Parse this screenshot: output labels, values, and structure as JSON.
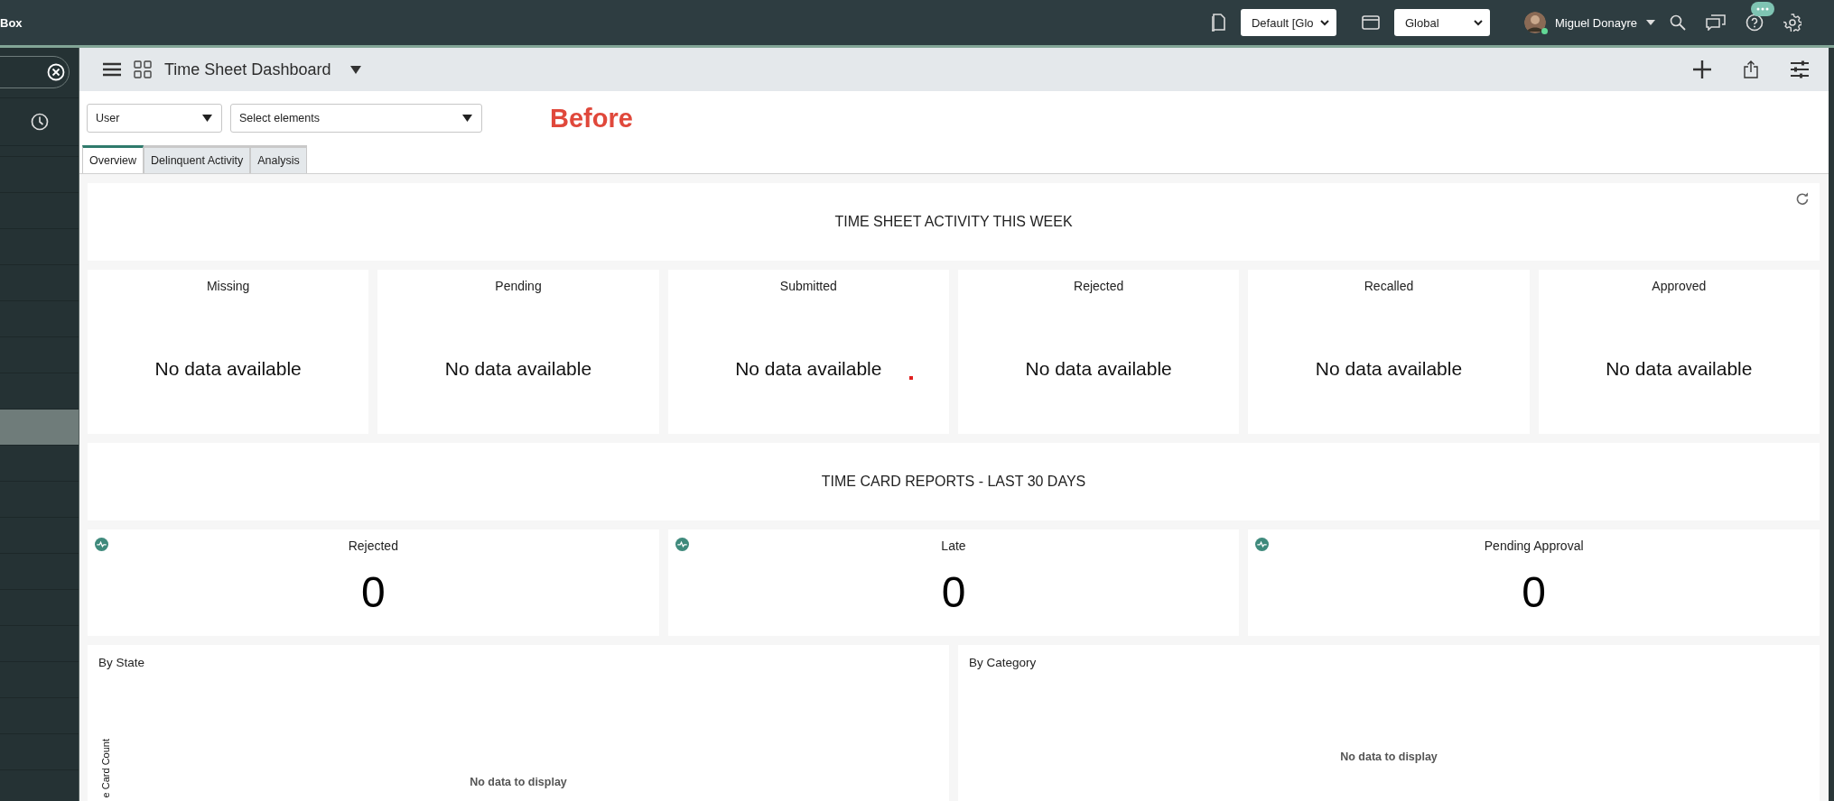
{
  "top_bar": {
    "app_title": "Box",
    "update_set": "Default [Glo",
    "scope": "Global",
    "user": {
      "name": "Miguel Donayre",
      "online": true
    }
  },
  "sidebar": {
    "rows": [
      {
        "selected": false
      },
      {
        "selected": false
      },
      {
        "selected": false
      },
      {
        "selected": false
      },
      {
        "selected": false
      },
      {
        "selected": false
      },
      {
        "selected": false
      },
      {
        "selected": false
      },
      {
        "selected": true
      },
      {
        "selected": false
      },
      {
        "selected": false
      },
      {
        "selected": false
      },
      {
        "selected": false
      },
      {
        "selected": false
      },
      {
        "selected": false
      },
      {
        "selected": false
      },
      {
        "selected": false
      },
      {
        "selected": false
      }
    ]
  },
  "header": {
    "title": "Time Sheet Dashboard"
  },
  "filters": [
    {
      "label": "User"
    },
    {
      "label": "Select elements"
    }
  ],
  "annotation": "Before",
  "tabs": [
    {
      "label": "Overview",
      "selected": true
    },
    {
      "label": "Delinquent Activity",
      "selected": false
    },
    {
      "label": "Analysis",
      "selected": false
    }
  ],
  "activity": {
    "title": "TIME SHEET ACTIVITY THIS WEEK",
    "cards": [
      {
        "title": "Missing",
        "message": "No data available"
      },
      {
        "title": "Pending",
        "message": "No data available"
      },
      {
        "title": "Submitted",
        "message": "No data available"
      },
      {
        "title": "Rejected",
        "message": "No data available"
      },
      {
        "title": "Recalled",
        "message": "No data available"
      },
      {
        "title": "Approved",
        "message": "No data available"
      }
    ]
  },
  "reports": {
    "title": "TIME CARD REPORTS - LAST 30 DAYS",
    "cards": [
      {
        "title": "Rejected",
        "value": "0"
      },
      {
        "title": "Late",
        "value": "0"
      },
      {
        "title": "Pending Approval",
        "value": "0"
      }
    ]
  },
  "charts": [
    {
      "title": "By State",
      "y_label": "e Card Count",
      "message": "No data to display"
    },
    {
      "title": "By Category",
      "message": "No data to display"
    }
  ]
}
